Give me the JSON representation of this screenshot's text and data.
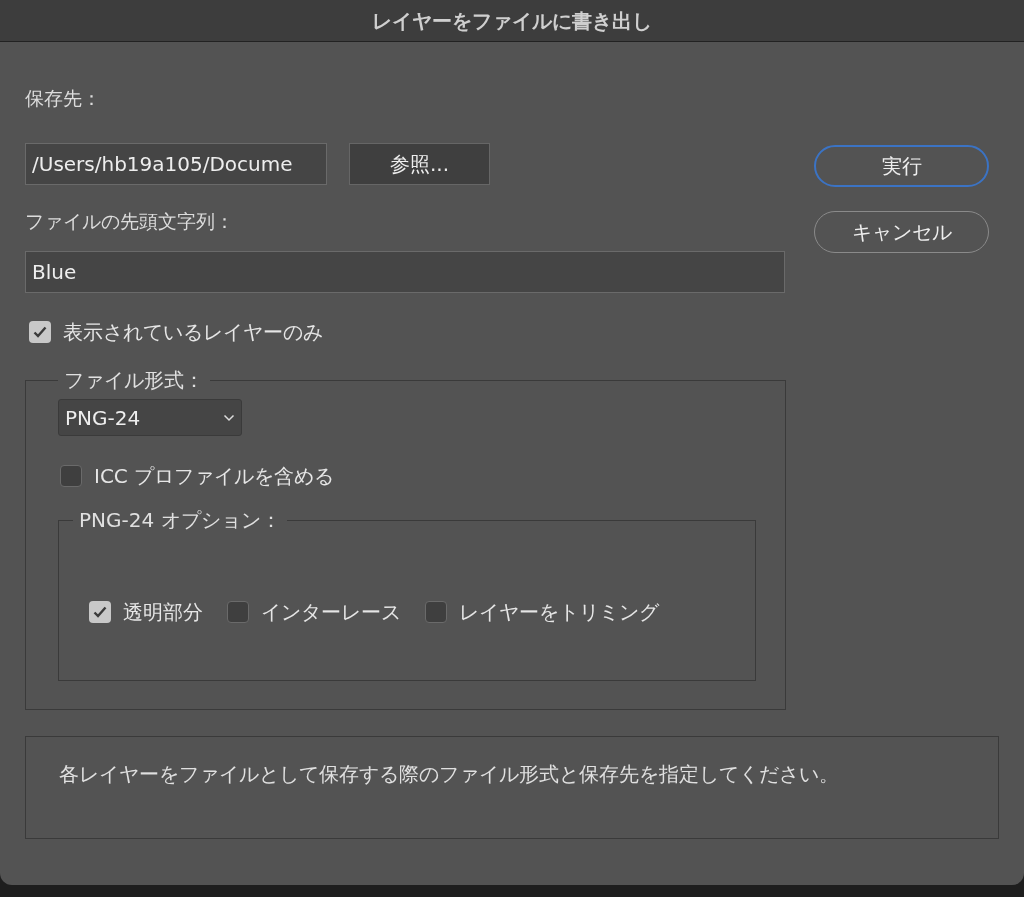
{
  "window": {
    "title": "レイヤーをファイルに書き出し"
  },
  "destination": {
    "label": "保存先：",
    "path": "/Users/hb19a105/Docume",
    "browse_button": "参照..."
  },
  "buttons": [
    {
      "label": "実行",
      "default": true
    },
    {
      "label": "キャンセル",
      "default": false
    }
  ],
  "prefix": {
    "label": "ファイルの先頭文字列：",
    "value": "Blue"
  },
  "visible_layers_only": {
    "label": "表示されているレイヤーのみ",
    "checked": true
  },
  "file_format": {
    "legend": "ファイル形式：",
    "format": "PNG-24",
    "icc_profile": {
      "label": "ICC プロファイルを含める",
      "checked": false
    },
    "options": {
      "legend": "PNG-24 オプション：",
      "items": [
        {
          "label": "透明部分",
          "checked": true
        },
        {
          "label": "インターレース",
          "checked": false
        },
        {
          "label": "レイヤーをトリミング",
          "checked": false
        }
      ]
    }
  },
  "description": "各レイヤーをファイルとして保存する際のファイル形式と保存先を指定してください。"
}
